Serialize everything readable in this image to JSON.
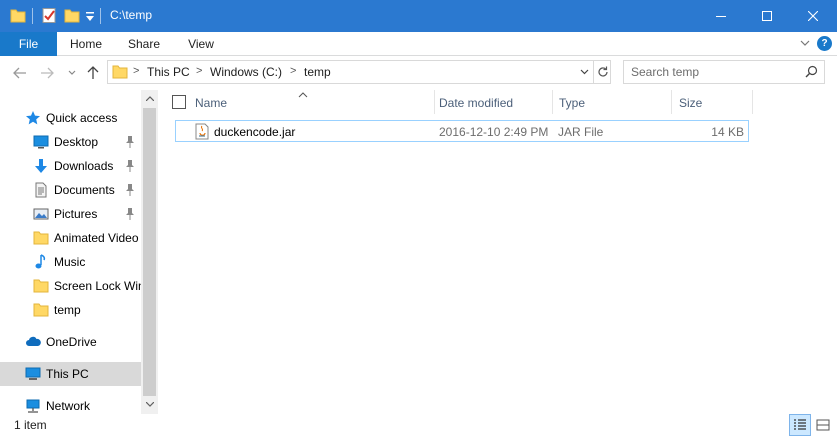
{
  "window": {
    "title": "C:\\temp"
  },
  "ribbon": {
    "tabs": [
      "File",
      "Home",
      "Share",
      "View"
    ]
  },
  "address": {
    "crumbs": [
      "This PC",
      "Windows (C:)",
      "temp"
    ]
  },
  "search": {
    "placeholder": "Search temp"
  },
  "nav": {
    "items": [
      {
        "label": "Quick access",
        "icon": "star-icon"
      },
      {
        "label": "Desktop",
        "icon": "desktop-icon",
        "pinned": true
      },
      {
        "label": "Downloads",
        "icon": "download-icon",
        "pinned": true
      },
      {
        "label": "Documents",
        "icon": "documents-icon",
        "pinned": true
      },
      {
        "label": "Pictures",
        "icon": "pictures-icon",
        "pinned": true
      },
      {
        "label": "Animated Video",
        "icon": "folder-icon"
      },
      {
        "label": "Music",
        "icon": "music-icon"
      },
      {
        "label": "Screen Lock Win",
        "icon": "folder-icon"
      },
      {
        "label": "temp",
        "icon": "folder-icon"
      },
      {
        "label": "OneDrive",
        "icon": "cloud-icon"
      },
      {
        "label": "This PC",
        "icon": "computer-icon",
        "selected": true
      },
      {
        "label": "Network",
        "icon": "network-icon"
      }
    ]
  },
  "columns": {
    "name": "Name",
    "date": "Date modified",
    "type": "Type",
    "size": "Size"
  },
  "files": [
    {
      "name": "duckencode.jar",
      "date": "2016-12-10 2:49 PM",
      "type": "JAR File",
      "size": "14 KB",
      "icon": "jar-file-icon"
    }
  ],
  "status": {
    "item_count": "1 item"
  },
  "colors": {
    "titlebar": "#2b79d0",
    "file_tab": "#1979ca",
    "selection_border": "#99d1ff",
    "folder": "#ffd865"
  }
}
